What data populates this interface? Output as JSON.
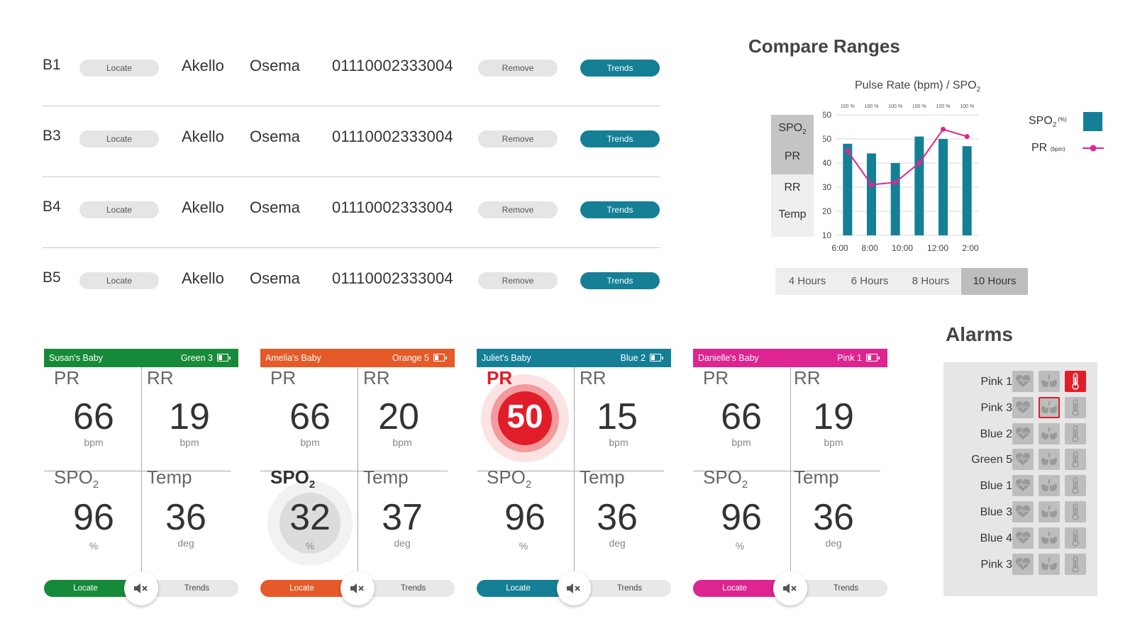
{
  "patients": [
    {
      "bed": "B1",
      "locate": "Locate",
      "first": "Akello",
      "last": "Osema",
      "id": "01110002333004",
      "remove": "Remove",
      "trends": "Trends"
    },
    {
      "bed": "B3",
      "locate": "Locate",
      "first": "Akello",
      "last": "Osema",
      "id": "01110002333004",
      "remove": "Remove",
      "trends": "Trends"
    },
    {
      "bed": "B4",
      "locate": "Locate",
      "first": "Akello",
      "last": "Osema",
      "id": "01110002333004",
      "remove": "Remove",
      "trends": "Trends"
    },
    {
      "bed": "B5",
      "locate": "Locate",
      "first": "Akello",
      "last": "Osema",
      "id": "01110002333004",
      "remove": "Remove",
      "trends": "Trends"
    }
  ],
  "compare": {
    "title": "Compare Ranges",
    "vitals": [
      {
        "label": "SPO",
        "sub": "2",
        "selected": true
      },
      {
        "label": "PR",
        "selected": true
      },
      {
        "label": "RR",
        "selected": false
      },
      {
        "label": "Temp",
        "selected": false
      }
    ],
    "ranges": [
      "4 Hours",
      "6 Hours",
      "8 Hours",
      "10 Hours"
    ],
    "active_range": "10 Hours",
    "legend": {
      "spo2_label": "SPO",
      "spo2_sub": "2",
      "spo2_unit": "(%)",
      "pr_label": "PR",
      "pr_unit": "(bpm)"
    },
    "colors": {
      "bar": "#157f96",
      "line": "#e0258c"
    }
  },
  "chart_data": {
    "type": "bar",
    "title": "Pulse Rate (bpm) / SPO2",
    "categories": [
      "6:00",
      "",
      "8:00",
      "",
      "10:00",
      "",
      "12:00",
      "",
      "2:00"
    ],
    "x_ticks": [
      "6:00",
      "8:00",
      "10:00",
      "12:00",
      "2:00"
    ],
    "bar_labels": [
      "100 %",
      "100 %",
      "100 %",
      "100 %",
      "100 %",
      "100 %"
    ],
    "series": [
      {
        "name": "SPO2 (%)",
        "type": "bar",
        "values": [
          48,
          44,
          40,
          51,
          50,
          47
        ]
      },
      {
        "name": "PR (bpm)",
        "type": "line",
        "values": [
          45,
          31,
          32,
          40,
          54,
          51
        ]
      }
    ],
    "ylim": [
      10,
      60
    ],
    "y_ticks": [
      10,
      20,
      30,
      40,
      50,
      60
    ],
    "grid": true,
    "legend": "right"
  },
  "cards": [
    {
      "name": "Susan's Baby",
      "tag": "Green 3",
      "color": "#178a3a",
      "pr": {
        "label": "PR",
        "value": "66",
        "unit": "bpm"
      },
      "rr": {
        "label": "RR",
        "value": "19",
        "unit": "bpm"
      },
      "spo2": {
        "label": "SPO",
        "sub": "2",
        "value": "96",
        "unit": "%"
      },
      "temp": {
        "label": "Temp",
        "value": "36",
        "unit": "deg"
      },
      "alert": "none",
      "locate": "Locate",
      "trends": "Trends"
    },
    {
      "name": "Amelia's Baby",
      "tag": "Orange 5",
      "color": "#e55a28",
      "pr": {
        "label": "PR",
        "value": "66",
        "unit": "bpm"
      },
      "rr": {
        "label": "RR",
        "value": "20",
        "unit": "bpm"
      },
      "spo2": {
        "label": "SPO",
        "sub": "2",
        "value": "32",
        "unit": "%"
      },
      "temp": {
        "label": "Temp",
        "value": "37",
        "unit": "deg"
      },
      "alert": "spo2",
      "locate": "Locate",
      "trends": "Trends"
    },
    {
      "name": "Juliet's Baby",
      "tag": "Blue 2",
      "color": "#157f96",
      "pr": {
        "label": "PR",
        "value": "50",
        "unit": ""
      },
      "rr": {
        "label": "RR",
        "value": "15",
        "unit": "bpm"
      },
      "spo2": {
        "label": "SPO",
        "sub": "2",
        "value": "96",
        "unit": "%"
      },
      "temp": {
        "label": "Temp",
        "value": "36",
        "unit": "deg"
      },
      "alert": "pr",
      "locate": "Locate",
      "trends": "Trends"
    },
    {
      "name": "Danielle's Baby",
      "tag": "Pink 1",
      "color": "#dd2490",
      "pr": {
        "label": "PR",
        "value": "66",
        "unit": "bpm"
      },
      "rr": {
        "label": "RR",
        "value": "19",
        "unit": "bpm"
      },
      "spo2": {
        "label": "SPO",
        "sub": "2",
        "value": "96",
        "unit": "%"
      },
      "temp": {
        "label": "Temp",
        "value": "36",
        "unit": "deg"
      },
      "alert": "none",
      "locate": "Locate",
      "trends": "Trends"
    }
  ],
  "alarms": {
    "title": "Alarms",
    "rows": [
      {
        "label": "Pink 1",
        "heart": "normal",
        "lungs": "normal",
        "temp": "active"
      },
      {
        "label": "Pink 3",
        "heart": "normal",
        "lungs": "outlined",
        "temp": "normal"
      },
      {
        "label": "Blue 2",
        "heart": "normal",
        "lungs": "normal",
        "temp": "normal"
      },
      {
        "label": "Green 5",
        "heart": "normal",
        "lungs": "normal",
        "temp": "normal"
      },
      {
        "label": "Blue 1",
        "heart": "normal",
        "lungs": "normal",
        "temp": "normal"
      },
      {
        "label": "Blue 3",
        "heart": "normal",
        "lungs": "normal",
        "temp": "normal"
      },
      {
        "label": "Blue 4",
        "heart": "normal",
        "lungs": "normal",
        "temp": "normal"
      },
      {
        "label": "Pink 3",
        "heart": "normal",
        "lungs": "normal",
        "temp": "normal"
      }
    ]
  }
}
